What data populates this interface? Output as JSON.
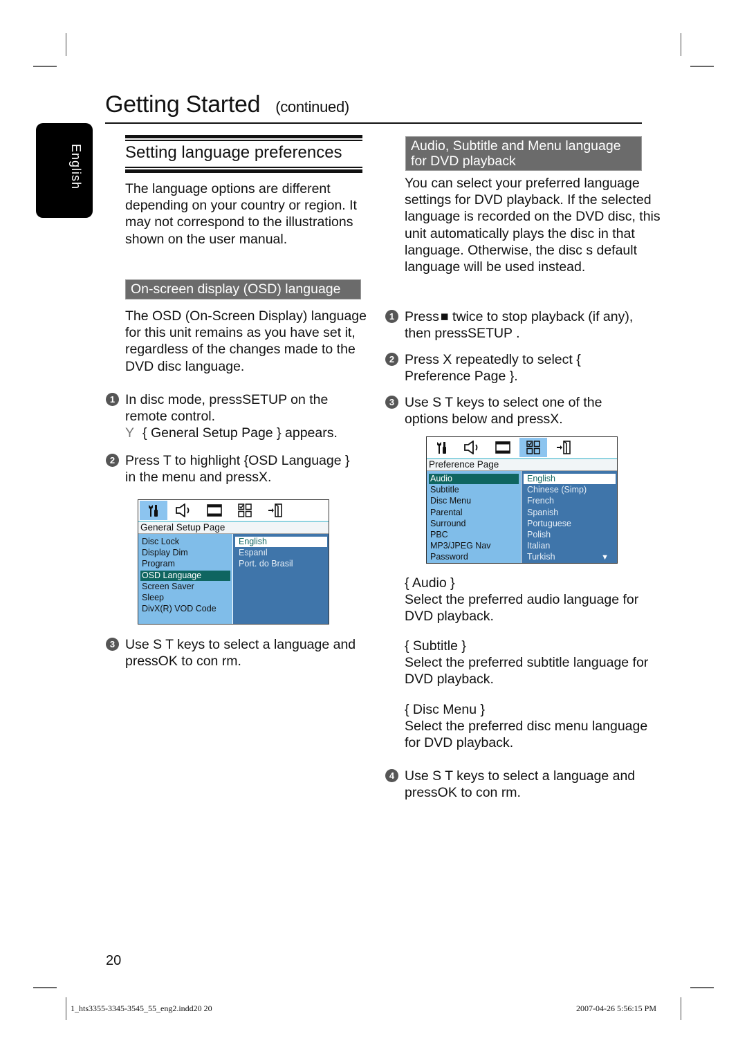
{
  "header": {
    "title": "Getting Started",
    "continued": "(continued)"
  },
  "side_tab": {
    "label": "English"
  },
  "left": {
    "section_title": "Setting language preferences",
    "intro": "The language options are different depending on your country or region.  It may not correspond to the illustrations shown on the user manual.",
    "osd_band": "On-screen display (OSD) language",
    "osd_intro": "The OSD (On-Screen Display) language for this unit remains as you have set it, regardless of the changes made to the DVD disc language.",
    "steps": [
      {
        "num": "1",
        "text": "In disc mode, pressSETUP on the remote control.",
        "result_bullet": "Y",
        "result": "{ General Setup Page } appears."
      },
      {
        "num": "2",
        "text": "Press T to highlight {OSD Language } in the menu and pressX."
      },
      {
        "num": "3",
        "text": "Use S T keys to select a language and pressOK to con rm."
      }
    ],
    "menu": {
      "icons": [
        "wrench-screwdriver-icon",
        "speaker-icon",
        "film-icon",
        "preference-grid-icon",
        "exit-door-icon"
      ],
      "active_icon": 0,
      "page_title": "General Setup Page",
      "items": [
        "Disc Lock",
        "Display Dim",
        "Program",
        "OSD Language",
        "Screen Saver",
        "Sleep",
        "DivX(R) VOD Code"
      ],
      "selected_item": 3,
      "options": [
        "English",
        "Espanıl",
        "Port. do Brasil"
      ],
      "selected_option": 0
    }
  },
  "right": {
    "band": "Audio, Subtitle and Menu language for DVD playback",
    "intro": "You can select your preferred language settings for DVD playback.  If the selected language is recorded on the DVD disc, this unit automatically plays the disc in that language.  Otherwise, the disc s default language will be used instead.",
    "steps": [
      {
        "num": "1",
        "text_a": "Press",
        "stop_symbol": "■",
        "text_b": " twice to stop playback (if any), then pressSETUP ."
      },
      {
        "num": "2",
        "text": "Press X repeatedly to select { Preference Page }."
      },
      {
        "num": "3",
        "text": "Use S T keys to select one of the options below and pressX."
      },
      {
        "num": "4",
        "text": "Use S T keys to select a language and pressOK to con rm."
      }
    ],
    "menu": {
      "icons": [
        "wrench-screwdriver-icon",
        "speaker-icon",
        "film-icon",
        "preference-grid-icon",
        "exit-door-icon"
      ],
      "active_icon": 3,
      "page_title": "Preference Page",
      "items": [
        "Audio",
        "Subtitle",
        "Disc Menu",
        "Parental",
        "Surround",
        "PBC",
        "MP3/JPEG Nav",
        "Password"
      ],
      "selected_item": 0,
      "options": [
        "English",
        "Chinese (Simp)",
        "French",
        "Spanish",
        "Portuguese",
        "Polish",
        "Italian",
        "Turkish"
      ],
      "selected_option": 0,
      "scroll_arrow": "▼"
    },
    "options_desc": [
      {
        "name": "{ Audio }",
        "desc": "Select the preferred audio language for DVD playback."
      },
      {
        "name": "{ Subtitle }",
        "desc": "Select the preferred subtitle language for DVD playback."
      },
      {
        "name": "{ Disc Menu }",
        "desc": "Select the preferred disc menu language for DVD playback."
      }
    ]
  },
  "footer": {
    "page_number": "20",
    "file": "1_hts3355-3345-3545_55_eng2.indd20   20",
    "date": "2007-04-26   5:56:15 PM"
  },
  "colors": {
    "band_gray": "#6b6b6b",
    "menu_left_blue": "#80bde9",
    "menu_right_blue": "#3f75aa",
    "menu_selected_teal": "#0f6560",
    "icon_active": "#8cc4ef"
  }
}
